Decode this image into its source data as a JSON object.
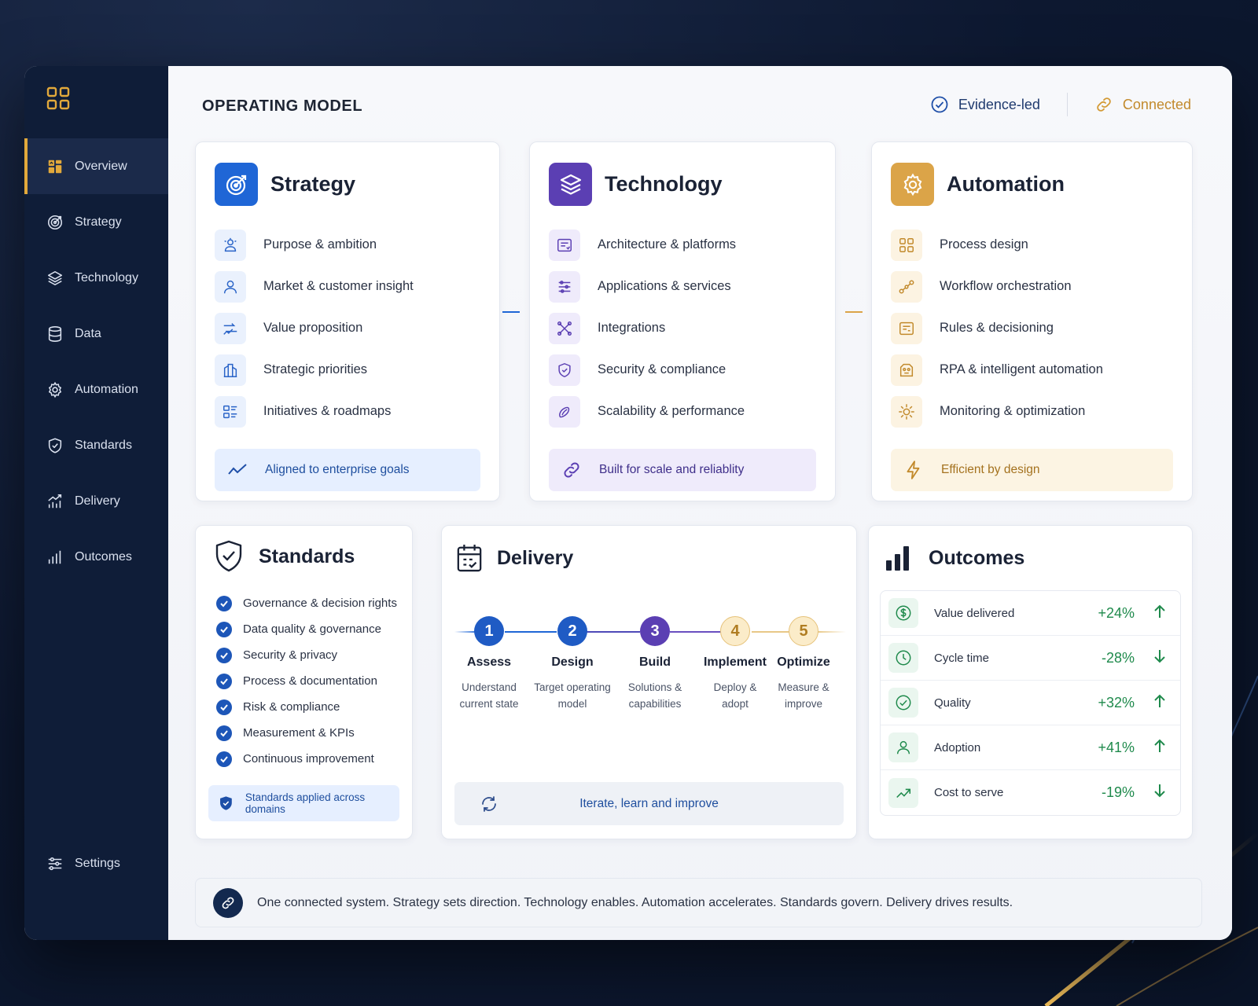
{
  "sidebar": {
    "items": [
      {
        "label": "Overview",
        "icon": "overview-icon",
        "active": true
      },
      {
        "label": "Strategy",
        "icon": "target-icon"
      },
      {
        "label": "Technology",
        "icon": "layers-icon"
      },
      {
        "label": "Data",
        "icon": "database-icon"
      },
      {
        "label": "Automation",
        "icon": "gear-icon"
      },
      {
        "label": "Standards",
        "icon": "shield-icon"
      },
      {
        "label": "Delivery",
        "icon": "growth-chart-icon"
      },
      {
        "label": "Outcomes",
        "icon": "bar-chart-icon"
      }
    ],
    "settings_label": "Settings"
  },
  "header": {
    "title": "OPERATING MODEL",
    "badge_evidence": "Evidence-led",
    "badge_connected": "Connected"
  },
  "colors": {
    "accent_gold": "#e2a93b",
    "strategy_blue": "#1f66d6",
    "technology_purple": "#5b3fb3",
    "automation_gold": "#dba448",
    "positive_green": "#1f8a4c"
  },
  "strategy": {
    "title": "Strategy",
    "items": [
      "Purpose & ambition",
      "Market & customer insight",
      "Value proposition",
      "Strategic priorities",
      "Initiatives & roadmaps"
    ],
    "footer": "Aligned to enterprise goals"
  },
  "technology": {
    "title": "Technology",
    "items": [
      "Architecture & platforms",
      "Applications & services",
      "Integrations",
      "Security & compliance",
      "Scalability & performance"
    ],
    "footer": "Built for scale and reliablity"
  },
  "automation": {
    "title": "Automation",
    "items": [
      "Process design",
      "Workflow orchestration",
      "Rules & decisioning",
      "RPA & intelligent automation",
      "Monitoring & optimization"
    ],
    "footer": "Efficient by design"
  },
  "standards": {
    "title": "Standards",
    "items": [
      "Governance & decision rights",
      "Data quality & governance",
      "Security & privacy",
      "Process & documentation",
      "Risk & compliance",
      "Measurement & KPIs",
      "Continuous improvement"
    ],
    "footer": "Standards applied across domains"
  },
  "delivery": {
    "title": "Delivery",
    "steps": [
      {
        "num": "1",
        "name": "Assess",
        "desc1": "Understand",
        "desc2": "current state"
      },
      {
        "num": "2",
        "name": "Design",
        "desc1": "Target operating",
        "desc2": "model"
      },
      {
        "num": "3",
        "name": "Build",
        "desc1": "Solutions &",
        "desc2": "capabilities"
      },
      {
        "num": "4",
        "name": "Implement",
        "desc1": "Deploy &",
        "desc2": "adopt"
      },
      {
        "num": "5",
        "name": "Optimize",
        "desc1": "Measure &",
        "desc2": "improve"
      }
    ],
    "footer": "Iterate, learn and improve"
  },
  "outcomes": {
    "title": "Outcomes",
    "rows": [
      {
        "label": "Value delivered",
        "value": "+24%",
        "direction": "up",
        "icon": "dollar-icon"
      },
      {
        "label": "Cycle time",
        "value": "-28%",
        "direction": "down",
        "icon": "clock-icon"
      },
      {
        "label": "Quality",
        "value": "+32%",
        "direction": "up",
        "icon": "check-circle-icon"
      },
      {
        "label": "Adoption",
        "value": "+41%",
        "direction": "up",
        "icon": "user-icon"
      },
      {
        "label": "Cost to serve",
        "value": "-19%",
        "direction": "down",
        "icon": "trend-icon"
      }
    ]
  },
  "footer": {
    "text": "One connected system. Strategy sets direction. Technology enables. Automation accelerates. Standards govern. Delivery drives results."
  }
}
